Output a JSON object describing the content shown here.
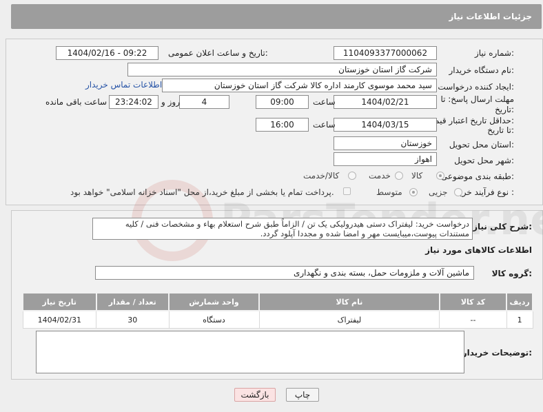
{
  "header": {
    "title": "جزئیات اطلاعات نیاز"
  },
  "form": {
    "need_number_label": "شماره نیاز:",
    "need_number": "1104093377000062",
    "announce_label": "تاریخ و ساعت اعلان عمومی:",
    "announce_value": "1404/02/16 - 09:22",
    "buyer_org_label": "نام دستگاه خریدار:",
    "buyer_org": "شرکت گاز استان خوزستان",
    "creator_label": "ایجاد کننده درخواست:",
    "creator": "سید محمد موسوی کارمند اداره کالا شرکت گاز استان خوزستان",
    "contact_link": "اطلاعات تماس خریدار",
    "deadline_label_1": "مهلت ارسال پاسخ: تا",
    "deadline_label_2": "تاریخ:",
    "deadline_date": "1404/02/21",
    "time_label": "ساعت",
    "deadline_time": "09:00",
    "days": "4",
    "days_label": "روز و",
    "remaining": "23:24:02",
    "remaining_label": "ساعت باقی مانده",
    "validity_label_1": "حداقل تاریخ اعتبار قیمت:",
    "validity_label_2": "تا تاریخ:",
    "validity_date": "1404/03/15",
    "validity_time": "16:00",
    "province_label": "استان محل تحویل:",
    "province": "خوزستان",
    "city_label": "شهر محل تحویل:",
    "city": "اهواز",
    "category_label": "طبقه بندی موضوعی:",
    "category_options": [
      "کالا",
      "خدمت",
      "کالا/خدمت"
    ],
    "process_label": "نوع فرآیند خرید :",
    "process_options": [
      "جزیی",
      "متوسط"
    ],
    "payment_note": "پرداخت تمام یا بخشی از مبلغ خرید،از محل \"اسناد خزانه اسلامی\" خواهد بود."
  },
  "details": {
    "description_label": "شرح کلی نیاز:",
    "description": "درخواست خرید: لیفتراک دستی هیدرولیکی یک تن / الزاماً طبق شرح استعلام بهاء و مشخصات فنی / کلیه مستندات پیوست،میبایست مهر و امضا شده و مجددا آپلود گردد.",
    "goods_info_title": "اطلاعات کالاهای مورد نیاز",
    "goods_group_label": "گروه کالا:",
    "goods_group": "ماشین آلات و ملزومات حمل، بسته بندی و نگهداری",
    "table": {
      "headers": [
        "ردیف",
        "کد کالا",
        "نام کالا",
        "واحد شمارش",
        "تعداد / مقدار",
        "تاریخ نیاز"
      ],
      "rows": [
        [
          "1",
          "--",
          "لیفتراک",
          "دستگاه",
          "30",
          "1404/02/31"
        ]
      ]
    },
    "buyer_notes_label": "توضیحات خریدار:"
  },
  "buttons": {
    "print": "چاپ",
    "back": "بازگشت"
  },
  "watermark_text": "ParsTender.net"
}
